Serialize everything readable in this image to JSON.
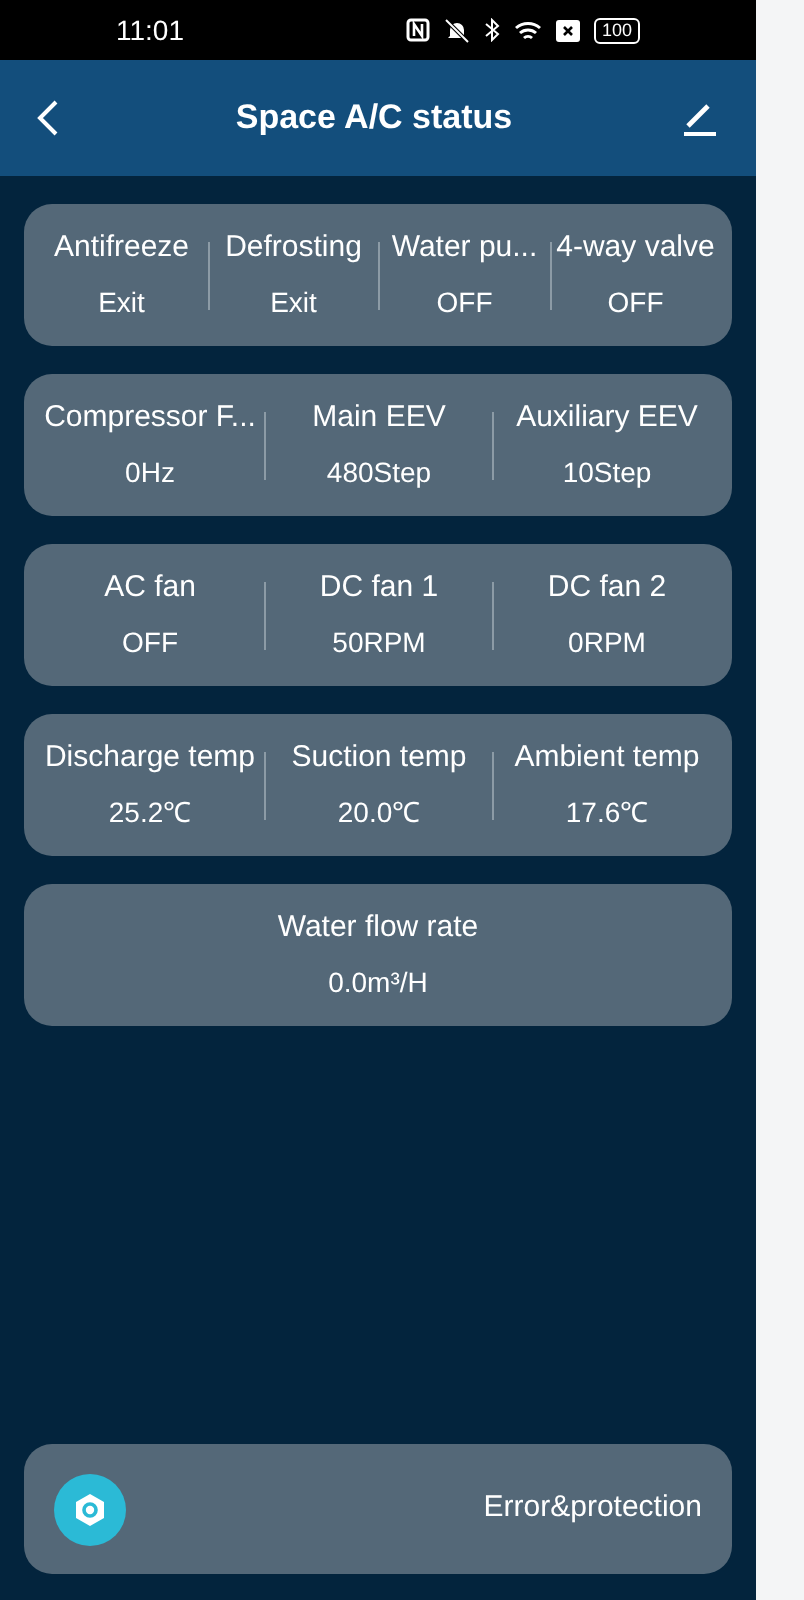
{
  "status_bar": {
    "time": "11:01",
    "battery": "100"
  },
  "header": {
    "title": "Space A/C status"
  },
  "groups": [
    {
      "items": [
        {
          "label": "Antifreeze",
          "value": "Exit"
        },
        {
          "label": "Defrosting",
          "value": "Exit"
        },
        {
          "label": "Water pu...",
          "value": "OFF"
        },
        {
          "label": "4-way valve",
          "value": "OFF"
        }
      ]
    },
    {
      "items": [
        {
          "label": "Compressor F...",
          "value": "0Hz"
        },
        {
          "label": "Main EEV",
          "value": "480Step"
        },
        {
          "label": "Auxiliary EEV",
          "value": "10Step"
        }
      ]
    },
    {
      "items": [
        {
          "label": "AC fan",
          "value": "OFF"
        },
        {
          "label": "DC fan 1",
          "value": "50RPM"
        },
        {
          "label": "DC fan 2",
          "value": "0RPM"
        }
      ]
    },
    {
      "items": [
        {
          "label": "Discharge temp",
          "value": "25.2℃"
        },
        {
          "label": "Suction temp",
          "value": "20.0℃"
        },
        {
          "label": "Ambient temp",
          "value": "17.6℃"
        }
      ]
    },
    {
      "items": [
        {
          "label": "Water flow rate",
          "value": "0.0m³/H"
        }
      ]
    }
  ],
  "footer": {
    "label": "Error&protection"
  }
}
